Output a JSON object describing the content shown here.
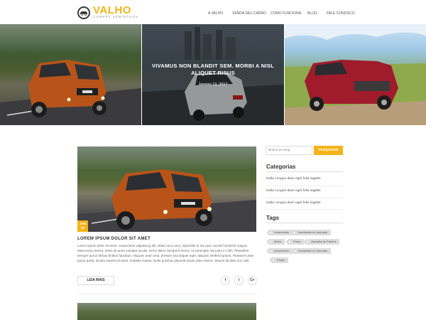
{
  "header": {
    "logo_name": "VALHO",
    "logo_tagline": "COMPRA SEMINOVOS",
    "nav": [
      "A VALHO",
      "VENDA SEU CARRO",
      "COMO FUNCIONA",
      "BLOG",
      "FALE CONOSCO"
    ]
  },
  "hero": {
    "title": "VIVAMUS NON BLANDIT SEM. MORBI A NISL ALIQUET RISUS",
    "date": "Janeiro 19, 2017"
  },
  "post": {
    "date_month": "JAN",
    "date_day": "20",
    "title": "LOREM IPSUM DOLOR SIT AMET",
    "excerpt": "Lorem ipsum dolor sit amet, consectetur adipiscing elit. Etiam arcu sem, imperdiet et dui quis, iaculis hendrerit magna. Maecenas viverra, tellus sit amet volutpat iaculis, lorem libero hendrerit lectus, ut venenatis nisi justo in nibh. Phasellus semper purus finibus finibus faucibus. Aliquam ante urna, pretium sed aliquet eget, aliquam eleifend ipsum. Praesent vitae purus porta, lacinia mauris sit amet, sodales massa. Nulla pulvinar placerat turpis vitae viverra. Mauris facilisis orci velit.",
    "read_more": "LEIA MAIS",
    "share": [
      "f",
      "t",
      "G+"
    ]
  },
  "sidebar": {
    "search_placeholder": "Busca no blog",
    "search_button": "PESQUISAR",
    "categories_heading": "Categorias",
    "categories": [
      "Nulla congue diam eget felis sagittis",
      "Nulla congue diam eget felis sagittis",
      "Nulla congue diam eget felis sagittis"
    ],
    "tags_heading": "Tags",
    "tags": [
      "Automóveis",
      "Novidades no mercado",
      "Motor",
      "Preço",
      "Garantia de Fábrica",
      "Automóveis",
      "Novidades no mercado",
      "Peças"
    ]
  },
  "colors": {
    "accent": "#f3b41a",
    "text": "#333333"
  }
}
